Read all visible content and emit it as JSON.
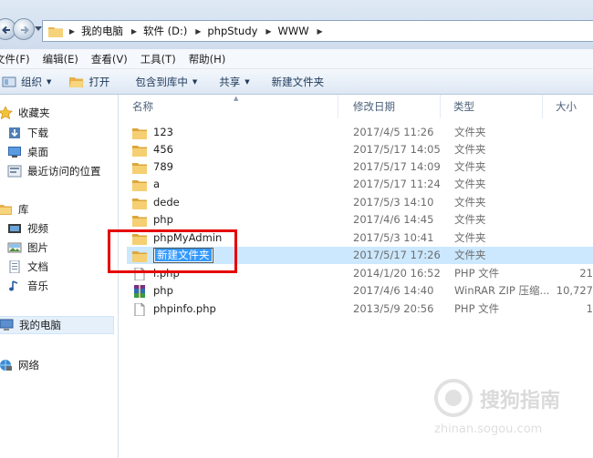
{
  "address_bar": {
    "crumbs": [
      "我的电脑",
      "软件 (D:)",
      "phpStudy",
      "WWW"
    ]
  },
  "menu": [
    "文件(F)",
    "编辑(E)",
    "查看(V)",
    "工具(T)",
    "帮助(H)"
  ],
  "toolbar": {
    "organize": "组织",
    "open": "打开",
    "include_in_library": "包含到库中",
    "share": "共享",
    "new_folder": "新建文件夹"
  },
  "nav": {
    "favorites": "收藏夹",
    "downloads": "下载",
    "desktop": "桌面",
    "recent": "最近访问的位置",
    "libraries": "库",
    "videos": "视频",
    "pictures": "图片",
    "documents": "文档",
    "music": "音乐",
    "computer": "我的电脑",
    "network": "网络"
  },
  "columns": {
    "name": "名称",
    "date": "修改日期",
    "type": "类型",
    "size": "大小"
  },
  "files": [
    {
      "name": "123",
      "date": "2017/4/5 11:26",
      "type": "文件夹",
      "size": ""
    },
    {
      "name": "456",
      "date": "2017/5/17 14:05",
      "type": "文件夹",
      "size": ""
    },
    {
      "name": "789",
      "date": "2017/5/17 14:09",
      "type": "文件夹",
      "size": ""
    },
    {
      "name": "a",
      "date": "2017/5/17 11:24",
      "type": "文件夹",
      "size": ""
    },
    {
      "name": "dede",
      "date": "2017/5/3 14:10",
      "type": "文件夹",
      "size": ""
    },
    {
      "name": "php",
      "date": "2017/4/6 14:45",
      "type": "文件夹",
      "size": ""
    },
    {
      "name": "phpMyAdmin",
      "date": "2017/5/3 10:41",
      "type": "文件夹",
      "size": ""
    },
    {
      "name": "新建文件夹",
      "date": "2017/5/17 17:26",
      "type": "文件夹",
      "size": ""
    },
    {
      "name": "l.php",
      "date": "2014/1/20 16:52",
      "type": "PHP 文件",
      "size": "21"
    },
    {
      "name": "php",
      "date": "2017/4/6 14:40",
      "type": "WinRAR ZIP 压缩...",
      "size": "10,727"
    },
    {
      "name": "phpinfo.php",
      "date": "2013/5/9 20:56",
      "type": "PHP 文件",
      "size": "1"
    }
  ],
  "watermark": {
    "brand": "搜狗指南",
    "url": "zhinan.sogou.com"
  }
}
